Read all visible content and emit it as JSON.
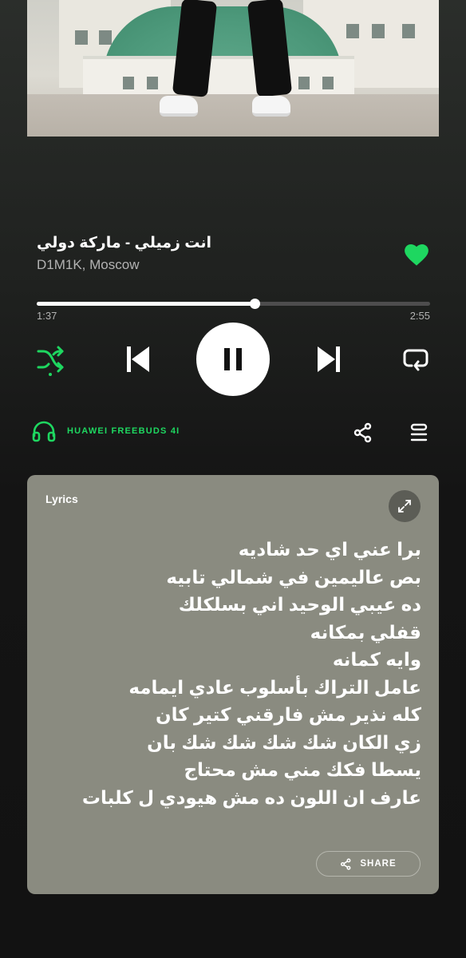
{
  "track": {
    "title": "انت زميلي - ماركة دولي",
    "artist": "D1M1K, Moscow",
    "liked": true
  },
  "playback": {
    "current_time": "1:37",
    "total_time": "2:55",
    "progress_fraction": 0.554,
    "is_playing": true,
    "shuffle_on": true
  },
  "device": {
    "label": "HUAWEI FREEBUDS 4I"
  },
  "lyrics": {
    "label": "Lyrics",
    "lines": [
      "برا عني اي حد شاديه",
      "بص عاليمين في شمالي تابيه",
      "ده عيبي الوحيد اني بسلكلك",
      "قفلي بمكانه",
      "وايه كمانه",
      "عامل التراك بأسلوب عادي ايمامه",
      "كله نذير مش فارقني كتير كان",
      "زي الكان شك شك شك شك بان",
      "يسطا فكك مني مش محتاج",
      "عارف ان اللون ده مش هيودي ل كلبات"
    ],
    "share_label": "SHARE"
  },
  "colors": {
    "accent": "#1ed760",
    "lyrics_card": "#8a8b80",
    "background": "#121212"
  },
  "icons": {
    "shuffle": "shuffle-icon",
    "previous": "skip-previous-icon",
    "pause": "pause-icon",
    "next": "skip-next-icon",
    "repeat": "repeat-icon",
    "heart": "heart-icon",
    "headphones": "headphones-icon",
    "share": "share-icon",
    "queue": "queue-icon",
    "expand": "expand-icon"
  }
}
